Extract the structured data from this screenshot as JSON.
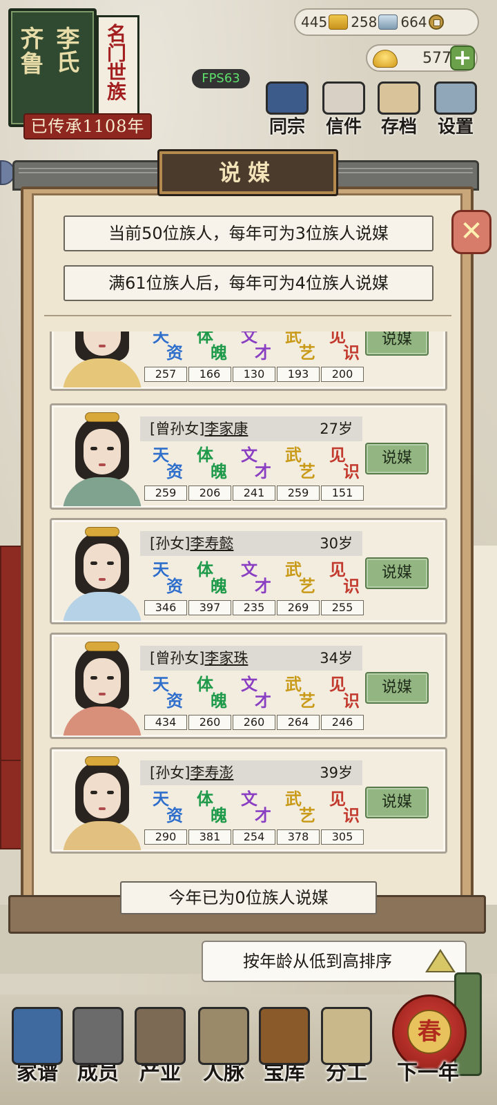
{
  "family": {
    "surname": "李氏",
    "region": "齐鲁",
    "rank": "名门世族",
    "lineage": "已传承1108年"
  },
  "resources": {
    "gold": "445",
    "silver": "258",
    "coin": "664",
    "ingot": "577"
  },
  "fps": "FPS63",
  "top_menu": [
    {
      "label": "同宗",
      "icon": "books-icon"
    },
    {
      "label": "信件",
      "icon": "letter-icon"
    },
    {
      "label": "存档",
      "icon": "save-scroll-icon"
    },
    {
      "label": "设置",
      "icon": "gear-icon"
    }
  ],
  "dialog": {
    "title": "说媒",
    "info_current": "当前50位族人，每年可为3位族人说媒",
    "info_next": "满61位族人后，每年可为4位族人说媒",
    "close_icon": "close-icon"
  },
  "stat_labels": [
    {
      "c1": "天",
      "c2": "资",
      "color": "#2f6fcc"
    },
    {
      "c1": "体",
      "c2": "魄",
      "color": "#1f9a4a"
    },
    {
      "c1": "文",
      "c2": "才",
      "color": "#8a3fc2"
    },
    {
      "c1": "武",
      "c2": "艺",
      "color": "#c99a18"
    },
    {
      "c1": "见",
      "c2": "识",
      "color": "#c23a2e"
    }
  ],
  "candidates": [
    {
      "relation": "",
      "name": "",
      "age": "",
      "stats": [
        "257",
        "166",
        "130",
        "193",
        "200"
      ],
      "robe": "#e6c679",
      "button": "说媒"
    },
    {
      "relation": "[曾孙女]",
      "name": "李家康",
      "age": "27岁",
      "stats": [
        "259",
        "206",
        "241",
        "259",
        "151"
      ],
      "robe": "#7fa38f",
      "button": "说媒"
    },
    {
      "relation": "[孙女]",
      "name": "李寿懿",
      "age": "30岁",
      "stats": [
        "346",
        "397",
        "235",
        "269",
        "255"
      ],
      "robe": "#b5d2e6",
      "button": "说媒"
    },
    {
      "relation": "[曾孙女]",
      "name": "李家珠",
      "age": "34岁",
      "stats": [
        "434",
        "260",
        "260",
        "264",
        "246"
      ],
      "robe": "#d9907a",
      "button": "说媒"
    },
    {
      "relation": "[孙女]",
      "name": "李寿澎",
      "age": "39岁",
      "stats": [
        "290",
        "381",
        "254",
        "378",
        "305"
      ],
      "robe": "#e2c080",
      "button": "说媒"
    }
  ],
  "status": "今年已为0位族人说媒",
  "sort": {
    "label": "按年龄从低到高排序",
    "icon": "sort-triangle-icon"
  },
  "bottom_nav": [
    {
      "label": "家谱",
      "icon": "genealogy-book-icon",
      "color": "#3e6aa0"
    },
    {
      "label": "成员",
      "icon": "member-portrait-icon",
      "color": "#6b6b6b"
    },
    {
      "label": "产业",
      "icon": "building-icon",
      "color": "#7d6a55"
    },
    {
      "label": "人脉",
      "icon": "network-icon",
      "color": "#9a8a6a"
    },
    {
      "label": "宝库",
      "icon": "treasure-chest-icon",
      "color": "#8a5a2a"
    },
    {
      "label": "分工",
      "icon": "scroll-icon",
      "color": "#c9b88a"
    },
    {
      "label": "下一年",
      "icon": "lantern-icon",
      "color": "#b02a1e"
    }
  ],
  "next_year_char": "春"
}
